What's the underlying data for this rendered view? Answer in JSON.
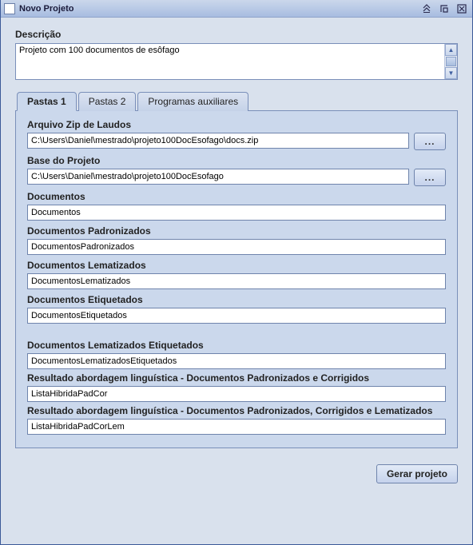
{
  "window": {
    "title": "Novo Projeto"
  },
  "description": {
    "label": "Descrição",
    "value": "Projeto com 100 documentos de esôfago"
  },
  "tabs": {
    "t1": "Pastas 1",
    "t2": "Pastas 2",
    "t3": "Programas auxiliares"
  },
  "fields": {
    "zip": {
      "label": "Arquivo Zip de Laudos",
      "value": "C:\\Users\\Daniel\\mestrado\\projeto100DocEsofago\\docs.zip"
    },
    "base": {
      "label": "Base do Projeto",
      "value": "C:\\Users\\Daniel\\mestrado\\projeto100DocEsofago"
    },
    "docs": {
      "label": "Documentos",
      "value": "Documentos"
    },
    "docsPad": {
      "label": "Documentos Padronizados",
      "value": "DocumentosPadronizados"
    },
    "docsLem": {
      "label": "Documentos Lematizados",
      "value": "DocumentosLematizados"
    },
    "docsEtiq": {
      "label": "Documentos Etiquetados",
      "value": "DocumentosEtiquetados"
    },
    "docsLemEtiq": {
      "label": "Documentos Lematizados Etiquetados",
      "value": "DocumentosLematizadosEtiquetados"
    },
    "resPadCor": {
      "label": "Resultado abordagem linguística - Documentos Padronizados e Corrigidos",
      "value": "ListaHibridaPadCor"
    },
    "resPadCorLem": {
      "label": "Resultado abordagem linguística - Documentos Padronizados, Corrigidos e Lematizados",
      "value": "ListaHibridaPadCorLem"
    }
  },
  "buttons": {
    "browse": "...",
    "generate": "Gerar projeto"
  }
}
